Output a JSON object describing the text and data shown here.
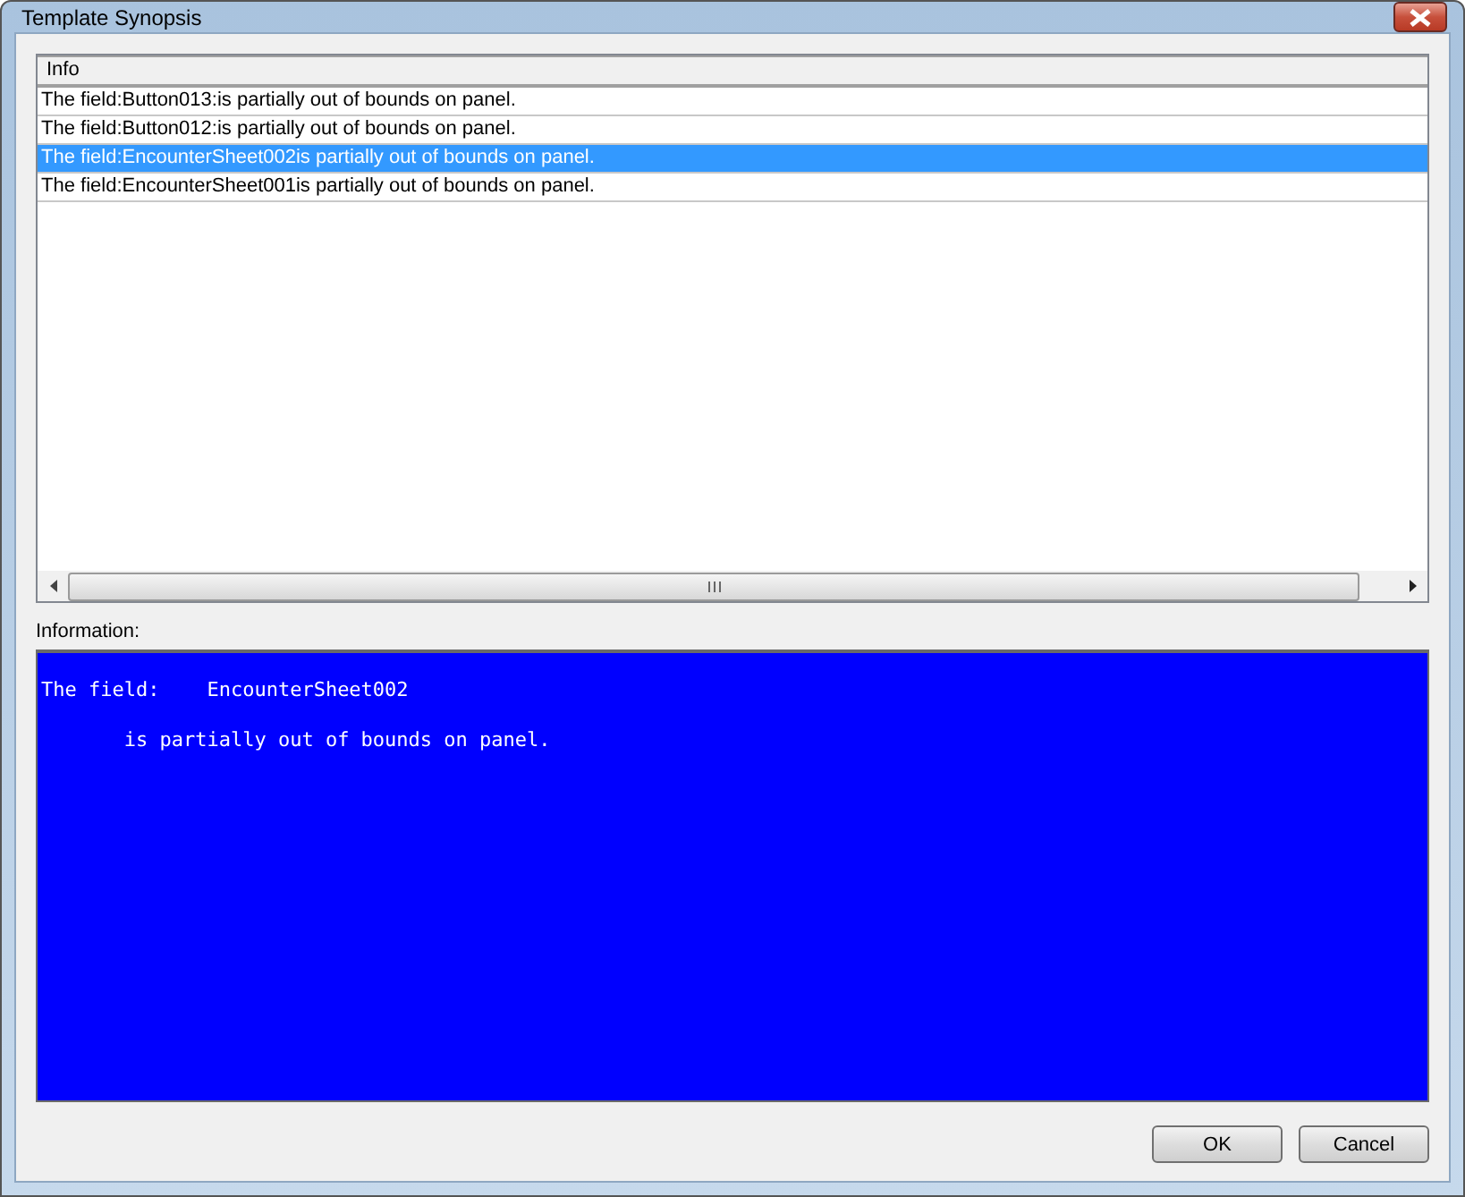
{
  "window": {
    "title": "Template Synopsis"
  },
  "table": {
    "columns": [
      "Info"
    ],
    "rows": [
      {
        "text": "The field:Button013:is partially out of bounds on panel.",
        "selected": false
      },
      {
        "text": "The field:Button012:is partially out of bounds on panel.",
        "selected": false
      },
      {
        "text": "The field:EncounterSheet002is partially out of bounds on panel.",
        "selected": true
      },
      {
        "text": "The field:EncounterSheet001is partially out of bounds on panel.",
        "selected": false
      }
    ]
  },
  "information": {
    "label": "Information:",
    "lines": [
      "The field:    EncounterSheet002",
      "       is partially out of bounds on panel."
    ]
  },
  "buttons": [
    "OK",
    "Cancel"
  ]
}
